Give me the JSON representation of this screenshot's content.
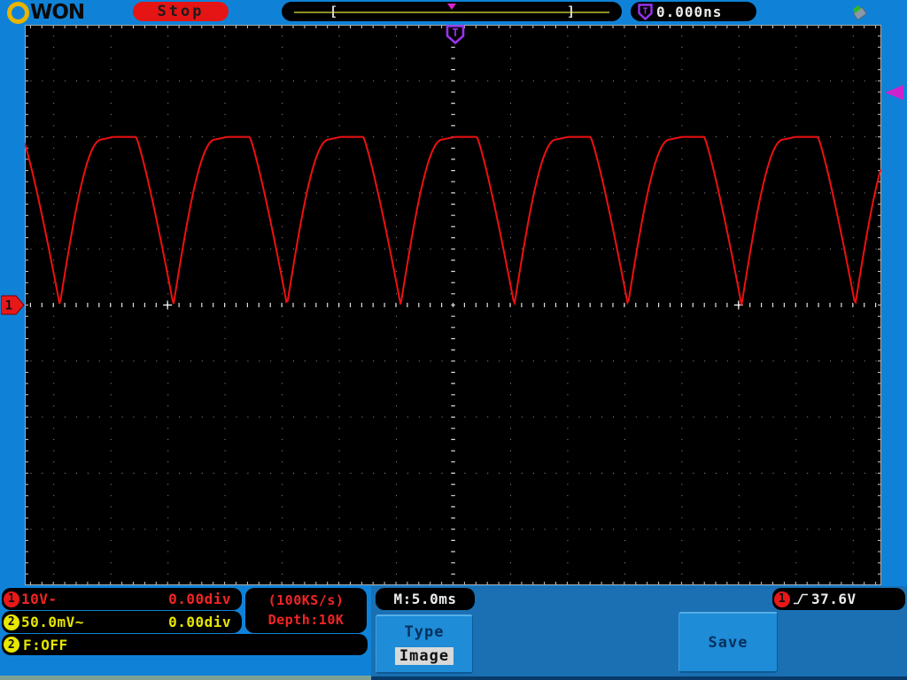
{
  "brand": {
    "logo": "WON"
  },
  "top_bar": {
    "run_state": "Stop",
    "horizontal_position": {
      "left_bracket": "[",
      "right_bracket": "]"
    },
    "trigger_shield": "T",
    "trigger_offset": "0.000ns"
  },
  "display": {
    "trigger_position_symbol": "T"
  },
  "markers": {
    "ch1": "1"
  },
  "status": {
    "ch1": {
      "badge": "1",
      "scale": "10V-",
      "position": "0.00div"
    },
    "ch2": {
      "badge": "2",
      "scale": "50.0mV~",
      "position": "0.00div"
    },
    "acquisition": {
      "sample_rate": "(100KS/s)",
      "depth": "Depth:10K"
    },
    "freq": {
      "badge": "2",
      "value": "F:OFF"
    },
    "timebase": "M:5.0ms",
    "trigger": {
      "badge": "1",
      "level": "37.6V",
      "edge": "rising"
    }
  },
  "menu": {
    "type_label": "Type",
    "type_value": "Image",
    "save_label": "Save"
  },
  "colors": {
    "frame": "#0f82d8",
    "panel": "#1a70b2",
    "wave": "#ee1010",
    "ch1": "#e81818",
    "ch2": "#e8e800",
    "trigger_purple": "#9933ee",
    "trigger_magenta": "#cc22cc"
  },
  "chart_data": {
    "type": "line",
    "title": "CH1 trace",
    "xlabel": "time, 5.0 ms/div",
    "ylabel": "CH1, 10 V/div",
    "waveform_shape": "full-wave rectified sine, tops clipped flat",
    "grid": {
      "h_divisions": 15,
      "v_divisions": 10
    },
    "period_div": 1.99,
    "first_valley_div": 0.6125,
    "valley_level_div": 0.0,
    "peak_level_div": 3.0,
    "rise_frac": 0.3666,
    "flat_frac": 0.3042,
    "trigger_level_div": 3.76,
    "trigger_level_volts": "37.6V"
  }
}
